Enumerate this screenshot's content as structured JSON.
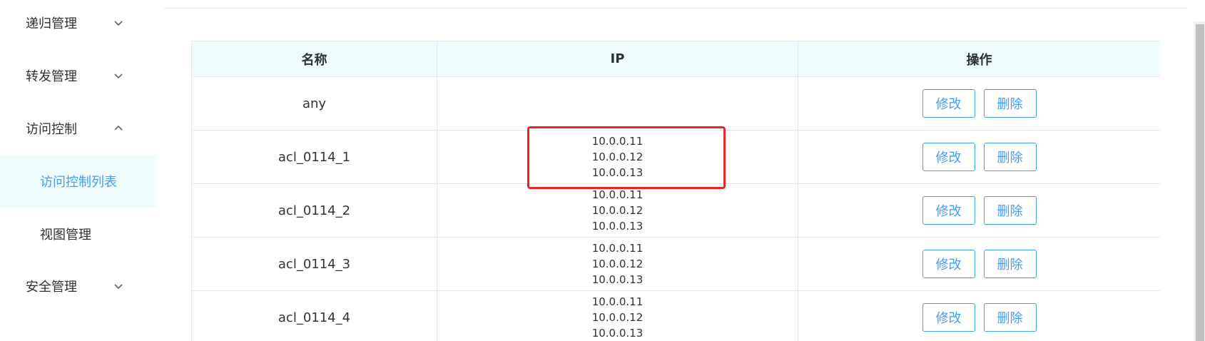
{
  "sidebar": {
    "items": [
      {
        "label": "递归管理",
        "chevron": "chevron-down-icon"
      },
      {
        "label": "转发管理",
        "chevron": "chevron-down-icon"
      },
      {
        "label": "访问控制",
        "chevron": "chevron-up-icon"
      },
      {
        "label": "访问控制列表",
        "active": true
      },
      {
        "label": "视图管理"
      },
      {
        "label": "安全管理",
        "chevron": "chevron-down-icon"
      }
    ]
  },
  "table": {
    "headers": [
      "名称",
      "IP",
      "操作"
    ],
    "rows": [
      {
        "name": "any",
        "ips": []
      },
      {
        "name": "acl_0114_1",
        "ips": [
          "10.0.0.11",
          "10.0.0.12",
          "10.0.0.13"
        ]
      },
      {
        "name": "acl_0114_2",
        "ips": [
          "10.0.0.11",
          "10.0.0.12",
          "10.0.0.13"
        ]
      },
      {
        "name": "acl_0114_3",
        "ips": [
          "10.0.0.11",
          "10.0.0.12",
          "10.0.0.13"
        ]
      },
      {
        "name": "acl_0114_4",
        "ips": [
          "10.0.0.11",
          "10.0.0.12",
          "10.0.0.13"
        ]
      }
    ],
    "edit_label": "修改",
    "delete_label": "删除"
  },
  "colors": {
    "accent": "#409eff",
    "highlight": "#e8262a",
    "active_bg": "#eefcfd"
  }
}
